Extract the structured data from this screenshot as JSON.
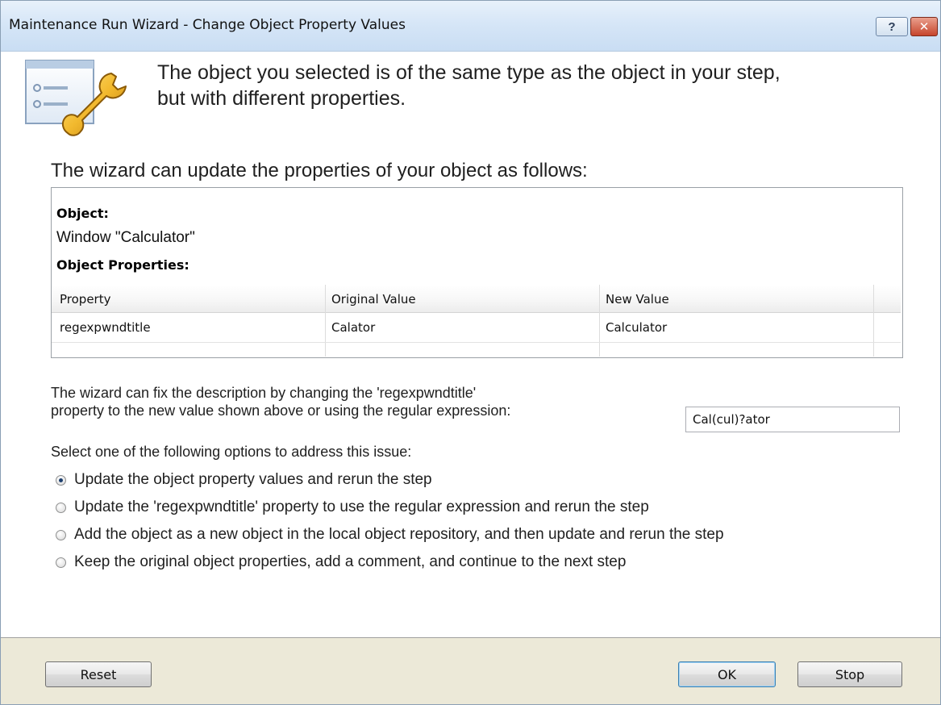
{
  "window": {
    "title": "Maintenance Run Wizard - Change Object Property Values",
    "help_label": "?",
    "close_label": "✕"
  },
  "header": {
    "icon": "wrench-settings-icon",
    "message": "The object you selected is of the same type as the object in your step, but with different properties."
  },
  "intro": "The wizard can update the properties of your object as follows:",
  "details": {
    "object_label": "Object:",
    "object_value": "Window \"Calculator\"",
    "properties_label": "Object Properties:",
    "columns": [
      "Property",
      "Original Value",
      "New Value"
    ],
    "rows": [
      [
        "regexpwndtitle",
        "Calator",
        "Calculator"
      ]
    ]
  },
  "fix": {
    "line1": "The wizard can fix the description by changing the 'regexpwndtitle'",
    "line2": "property to the new value shown above or using the regular expression:",
    "regex_value": "Cal(cul)?ator"
  },
  "select_text": "Select one of the following options to address this issue:",
  "options": [
    {
      "label": "Update the object property values and rerun the step",
      "checked": true
    },
    {
      "label": "Update the 'regexpwndtitle' property to use the regular expression and rerun the step",
      "checked": false
    },
    {
      "label": "Add the object as a new object in the local object repository, and then update and rerun the step",
      "checked": false
    },
    {
      "label": "Keep the original object properties, add a comment, and continue to the next step",
      "checked": false
    }
  ],
  "buttons": {
    "reset": "Reset",
    "ok": "OK",
    "stop": "Stop"
  }
}
